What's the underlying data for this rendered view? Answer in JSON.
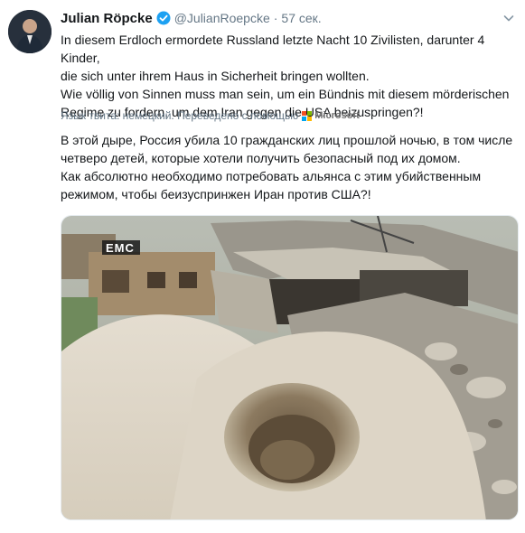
{
  "tweet": {
    "author_name": "Julian Röpcke",
    "handle": "@JulianRoepcke",
    "separator": "·",
    "timestamp": "57 сек.",
    "original_text": [
      "In diesem Erdloch ermordete Russland letzte Nacht 10 Zivilisten, darunter 4 Kinder,",
      "die sich unter ihrem Haus in Sicherheit bringen wollten.",
      "Wie völlig von Sinnen muss man sein, um ein Bündnis mit diesem mörderischen",
      "Regime zu fordern, um dem Iran gegen die USA beizuspringen?!"
    ],
    "translation_label": "Язык твита: немецкий. Переведено с помощью",
    "translation_provider": "Microsoft",
    "translated_text": [
      "В этой дыре, Россия убила 10 гражданских лиц прошлой ночью, в том числе",
      "четверо детей, которые хотели получить безопасный под их домом.",
      "Как абсолютно необходимо потребовать альянса с этим убийственным",
      "режимом, чтобы беизуспринжен Иран против США?!"
    ],
    "media_watermark": "EMC"
  },
  "colors": {
    "text": "#14171a",
    "secondary": "#657786",
    "verified_blue": "#1da1f2",
    "ms_red": "#f25022",
    "ms_green": "#7fba00",
    "ms_blue": "#00a4ef",
    "ms_yellow": "#ffb900"
  },
  "icons": {
    "avatar": "avatar",
    "verified": "verified-badge-icon",
    "menu": "chevron-down-icon",
    "microsoft": "microsoft-logo-icon"
  }
}
